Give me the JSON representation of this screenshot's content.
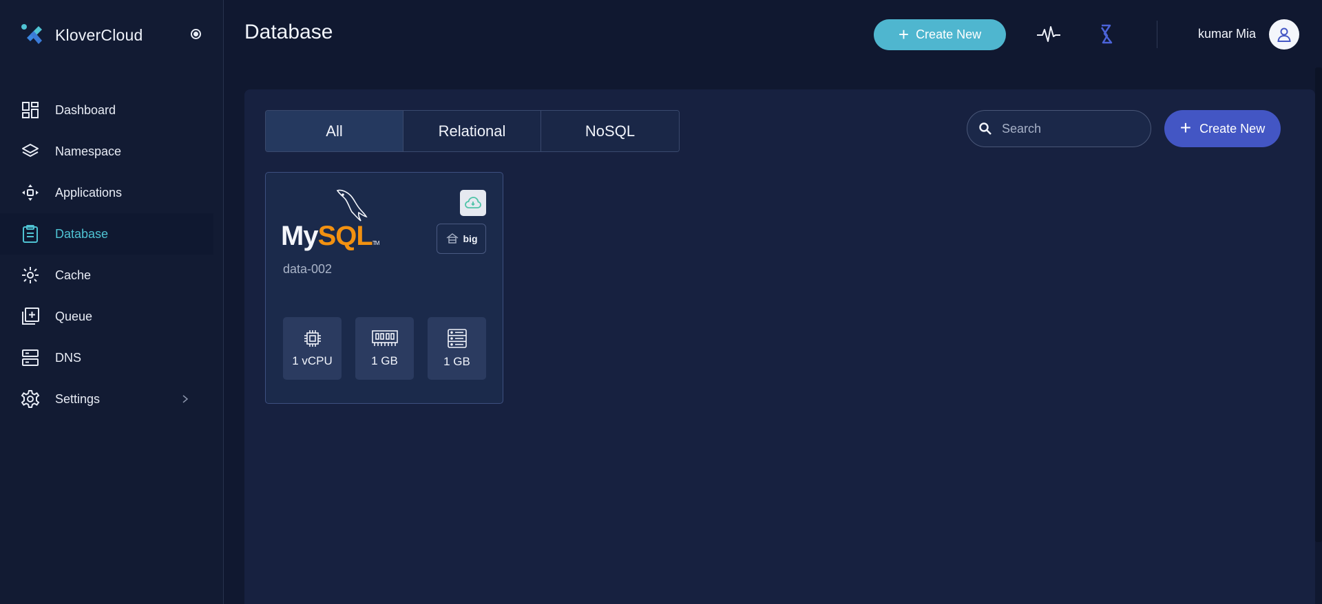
{
  "brand": {
    "name": "KloverCloud"
  },
  "sidebar": {
    "items": [
      {
        "label": "Dashboard",
        "icon": "dashboard-icon"
      },
      {
        "label": "Namespace",
        "icon": "layers-icon"
      },
      {
        "label": "Applications",
        "icon": "applications-icon"
      },
      {
        "label": "Database",
        "icon": "clipboard-icon",
        "active": true
      },
      {
        "label": "Cache",
        "icon": "cache-icon"
      },
      {
        "label": "Queue",
        "icon": "queue-icon"
      },
      {
        "label": "DNS",
        "icon": "server-icon"
      },
      {
        "label": "Settings",
        "icon": "gear-icon"
      }
    ]
  },
  "header": {
    "title": "Database",
    "create_label": "Create New",
    "user_name": "kumar Mia"
  },
  "filters": {
    "tabs": [
      "All",
      "Relational",
      "NoSQL"
    ],
    "active": "All"
  },
  "search": {
    "placeholder": "Search"
  },
  "toolbar": {
    "create_label": "Create New"
  },
  "database_card": {
    "engine": "MySQL",
    "engine_logo_parts": [
      "My",
      "SQL",
      "TM"
    ],
    "name": "data-002",
    "size_badge": "big",
    "specs": [
      {
        "icon": "cpu-icon",
        "label": "1 vCPU"
      },
      {
        "icon": "memory-icon",
        "label": "1 GB"
      },
      {
        "icon": "storage-icon",
        "label": "1 GB"
      }
    ]
  },
  "colors": {
    "accent_teal": "#4fb6cf",
    "accent_indigo": "#4356c4",
    "active_nav": "#4fc3d3",
    "mysql_orange": "#f29111"
  }
}
